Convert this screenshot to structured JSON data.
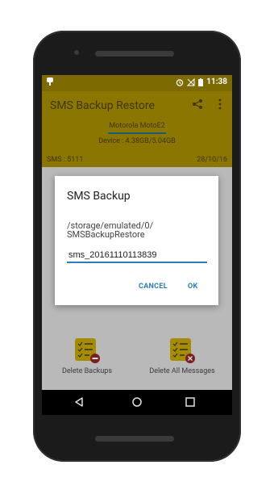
{
  "statusbar": {
    "time": "11:38"
  },
  "appbar": {
    "title": "SMS Backup Restore",
    "device_name": "Motorola MotoE2",
    "device_storage": "Device : 4.38GB/5.04GB",
    "sms_count": "SMS : 5111",
    "date": "28/10/16"
  },
  "actions": [
    {
      "label": "Delete Backups",
      "icon": "checklist-minus-icon",
      "badge_color": "#b71c1c"
    },
    {
      "label": "Delete All Messages",
      "icon": "checklist-x-icon",
      "badge_color": "#b71c1c"
    }
  ],
  "dialog": {
    "title": "SMS Backup",
    "path_line1": "/storage/emulated/0/",
    "path_line2": "SMSBackupRestore",
    "filename_value": "sms_20161110113839",
    "cancel_label": "CANCEL",
    "ok_label": "OK"
  },
  "navbar": {
    "back_icon": "triangle-back-icon",
    "home_icon": "circle-home-icon",
    "recent_icon": "square-recents-icon"
  },
  "colors": {
    "appbar": "#8a7600",
    "statusbar": "#7d6a00",
    "accent": "#2a7fb8"
  }
}
